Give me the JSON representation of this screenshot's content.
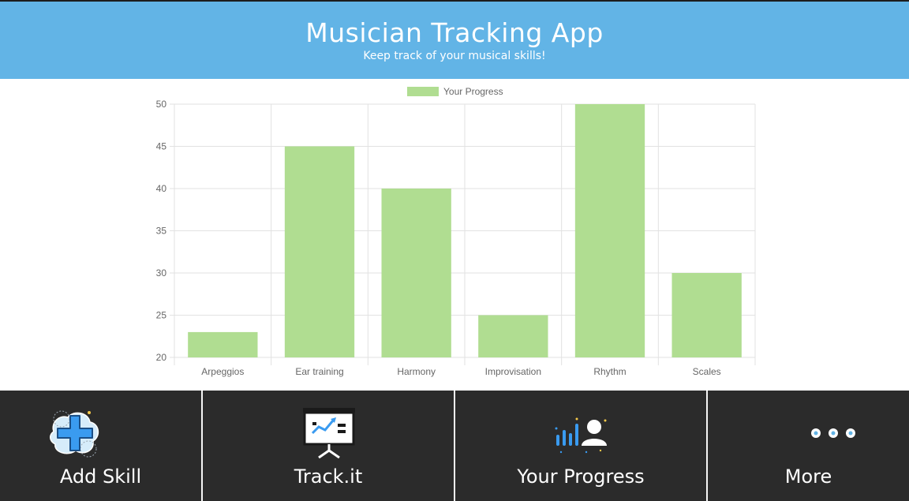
{
  "header": {
    "title": "Musician Tracking App",
    "subtitle": "Keep track of your musical skills!"
  },
  "chart_data": {
    "type": "bar",
    "categories": [
      "Arpeggios",
      "Ear training",
      "Harmony",
      "Improvisation",
      "Rhythm",
      "Scales"
    ],
    "series": [
      {
        "name": "Your Progress",
        "values": [
          23,
          45,
          40,
          25,
          50,
          30
        ],
        "color": "#b0dd91"
      }
    ],
    "ylim": [
      20,
      50
    ],
    "yticks": [
      20,
      25,
      30,
      35,
      40,
      45,
      50
    ],
    "grid": true,
    "legend": "top-center"
  },
  "nav": {
    "items": [
      {
        "label": "Add Skill",
        "icon": "add-skill-icon"
      },
      {
        "label": "Track.it",
        "icon": "presentation-board-icon"
      },
      {
        "label": "Your Progress",
        "icon": "progress-stats-icon"
      },
      {
        "label": "More",
        "icon": "more-dots-icon"
      }
    ]
  },
  "colors": {
    "header_bg": "#62b4e6",
    "nav_bg": "#2b2b2b",
    "bar": "#b0dd91"
  }
}
